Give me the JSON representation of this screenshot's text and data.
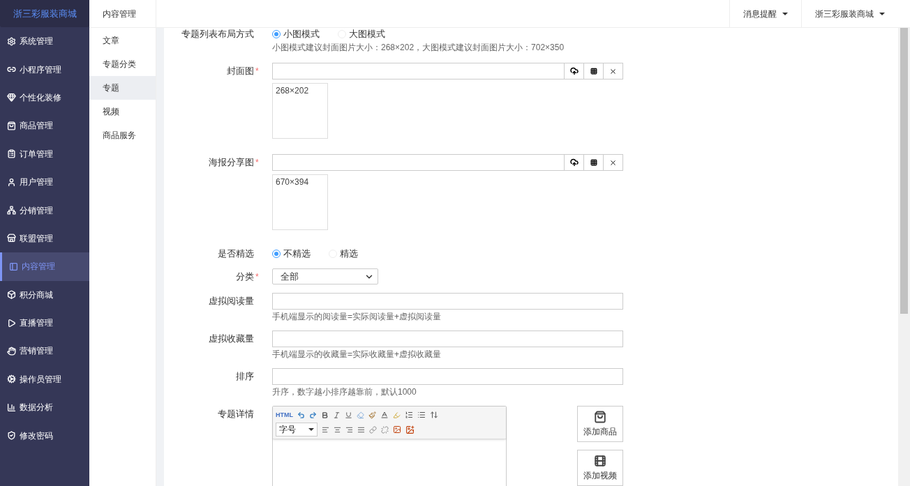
{
  "brand": "浙三彩服装商城",
  "sidebar": {
    "items": [
      {
        "label": "系统管理",
        "selected": false
      },
      {
        "label": "小程序管理",
        "selected": false
      },
      {
        "label": "个性化装修",
        "selected": false
      },
      {
        "label": "商品管理",
        "selected": false
      },
      {
        "label": "订单管理",
        "selected": false
      },
      {
        "label": "用户管理",
        "selected": false
      },
      {
        "label": "分销管理",
        "selected": false
      },
      {
        "label": "联盟管理",
        "selected": false
      },
      {
        "label": "内容管理",
        "selected": true
      },
      {
        "label": "积分商城",
        "selected": false
      },
      {
        "label": "直播管理",
        "selected": false
      },
      {
        "label": "营销管理",
        "selected": false
      },
      {
        "label": "操作员管理",
        "selected": false
      },
      {
        "label": "数据分析",
        "selected": false
      },
      {
        "label": "修改密码",
        "selected": false
      }
    ]
  },
  "subnav": {
    "title": "内容管理",
    "items": [
      {
        "label": "文章",
        "selected": false
      },
      {
        "label": "专题分类",
        "selected": false
      },
      {
        "label": "专题",
        "selected": true
      },
      {
        "label": "视频",
        "selected": false
      },
      {
        "label": "商品服务",
        "selected": false
      }
    ]
  },
  "topbar": {
    "items": [
      "消息提醒",
      "浙三彩服装商城"
    ]
  },
  "form": {
    "fields": [
      {
        "kind": "radio",
        "label": "专题列表布局方式",
        "options": [
          {
            "label": "小图模式",
            "selected": true
          },
          {
            "label": "大图模式",
            "selected": false
          }
        ],
        "help": "小图模式建议封面图片大小：268×202，大图模式建议封面图片大小：702×350"
      },
      {
        "kind": "image",
        "label": "封面图",
        "required_mark": "*",
        "preview": "268×202"
      },
      {
        "kind": "image",
        "label": "海报分享图",
        "required_mark": "*",
        "preview": "670×394"
      },
      {
        "kind": "radio",
        "label": "是否精选",
        "options": [
          {
            "label": "不精选",
            "selected": true
          },
          {
            "label": "精选",
            "selected": false
          }
        ]
      },
      {
        "kind": "select",
        "label": "分类",
        "required_mark": "*",
        "value": "全部"
      },
      {
        "kind": "text",
        "label": "虚拟阅读量",
        "help": "手机端显示的阅读量=实际阅读量+虚拟阅读量"
      },
      {
        "kind": "text",
        "label": "虚拟收藏量",
        "help": "手机端显示的收藏量=实际收藏量+虚拟收藏量"
      },
      {
        "kind": "text",
        "label": "排序",
        "help": "升序，数字越小排序越靠前，默认1000"
      },
      {
        "kind": "editor",
        "label": "专题详情",
        "html_label": "HTML",
        "font_size": "字号",
        "side_buttons": [
          "添加商品",
          "添加视频"
        ]
      }
    ]
  }
}
